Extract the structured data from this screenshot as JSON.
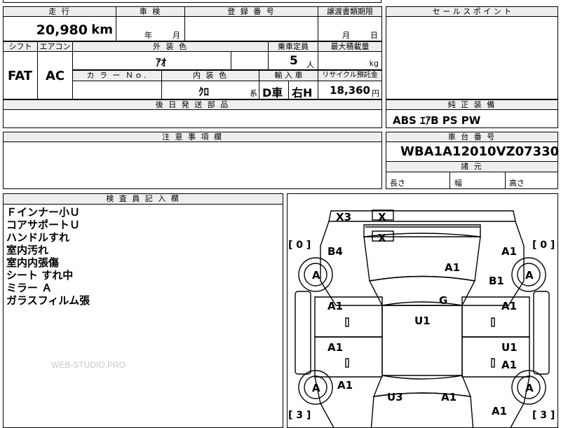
{
  "top_row": {
    "mileage_label": "走 行",
    "mileage_value": "20,980",
    "mileage_unit": "km",
    "inspection_label": "車 検",
    "inspection_year": "年",
    "inspection_month": "月",
    "registration_label": "登 録 番 号",
    "transfer_label": "譲渡書類期限",
    "transfer_month": "月",
    "transfer_day": "日"
  },
  "sales_point": {
    "label": "セ ー ル ス ポ イ ン ト"
  },
  "row2": {
    "shift_label": "シフト",
    "shift_value": "FAT",
    "ac_label": "エアコン",
    "ac_value": "AC",
    "ext_color_label": "外 装 色",
    "ext_color_value": "ｱｵ",
    "capacity_label": "乗車定員",
    "capacity_value": "5",
    "capacity_unit": "人",
    "load_label": "最大積載量",
    "load_unit": "kg",
    "color_no_label": "カ ラ ー Ｎｏ.",
    "int_color_label": "内 装 色",
    "int_color_value": "ｸﾛ",
    "int_color_suffix": "系",
    "import_label": "輸 入 車",
    "import_value_1": "D車",
    "import_value_2": "右H",
    "recycle_label": "リサイクル預託金",
    "recycle_value": "18,360",
    "recycle_unit": "円"
  },
  "later_parts": {
    "label": "後 日 発 送 部 品"
  },
  "equipment": {
    "label": "純 正 装 備",
    "value": "ABS ｴｱB PS PW"
  },
  "caution": {
    "label": "注 意 事 項 欄"
  },
  "chassis": {
    "label": "車 台 番 号",
    "value": "WBA1A12010VZ07330"
  },
  "dimensions": {
    "label": "諸 元",
    "length": "長さ",
    "width": "幅",
    "height": "高さ"
  },
  "inspector": {
    "label": "検 査 員 記 入 欄",
    "notes": [
      "Ｆインナー小Ｕ",
      "コアサポートＵ",
      "ハンドルすれ",
      "室内汚れ",
      "室内内張傷",
      "シート すれ中",
      "ミラー Ａ",
      "ガラスフィルム張"
    ],
    "watermark": "WEB-STUDIO.PRO"
  },
  "diagram": {
    "marks": {
      "x3": "X3",
      "x_top": "X",
      "x_mid": "X",
      "b4": "B4",
      "a1_front_right": "A1",
      "a1_hood": "A1",
      "b1": "B1",
      "g": "G",
      "a1_left_front_door": "A1",
      "a1_right_front_door": "A1",
      "u1_roof": "U1",
      "a1_left_rear_door": "A1",
      "u1_right_rear_door": "U1",
      "a1_right_rear_door": "A1",
      "a1_left_rear_fender": "A1",
      "u3": "U3",
      "a1_trunk": "A1",
      "a1_right_rear_fender": "A1"
    },
    "tires": {
      "front_left": "A",
      "front_right": "A",
      "rear_left": "A",
      "rear_right": "A"
    },
    "brackets": {
      "front_left": "[ 0 ]",
      "front_right": "[ 0 ]",
      "rear_left": "[ 3 ]",
      "rear_right": "[ 3 ]"
    }
  }
}
